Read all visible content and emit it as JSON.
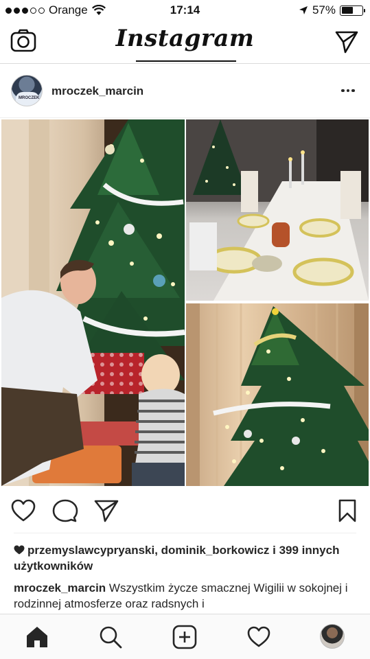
{
  "status_bar": {
    "carrier": "Orange",
    "time": "17:14",
    "battery_percent": "57%",
    "battery_level": 0.57,
    "signal_bars_filled": 3,
    "signal_bars_total": 5
  },
  "header": {
    "logo": "Instagram",
    "icons": [
      "camera-icon",
      "direct-send-icon"
    ]
  },
  "post": {
    "username": "mroczek_marcin",
    "avatar_shirt_text": "MROCZEK",
    "more_icon": "more-dots-icon",
    "photos": [
      {
        "name": "photo-man-child-tree"
      },
      {
        "name": "photo-table-setting"
      },
      {
        "name": "photo-christmas-tree"
      }
    ],
    "actions": [
      "heart-icon",
      "comment-icon",
      "share-icon",
      "bookmark-icon"
    ],
    "likes_text": "przemyslawcypryanski, dominik_borkowicz i 399 innych użytkowników",
    "caption_user": "mroczek_marcin",
    "caption_text": "Wszystkim życze smacznej Wigilii w sokojnej i rodzinnej atmosferze oraz  radsnych i"
  },
  "tabbar": {
    "tabs": [
      "home-icon",
      "search-icon",
      "add-post-icon",
      "activity-heart-icon",
      "profile-avatar"
    ]
  },
  "colors": {
    "text": "#262626",
    "divider": "#dbdbdb",
    "tabbar_bg": "#fafafa"
  }
}
